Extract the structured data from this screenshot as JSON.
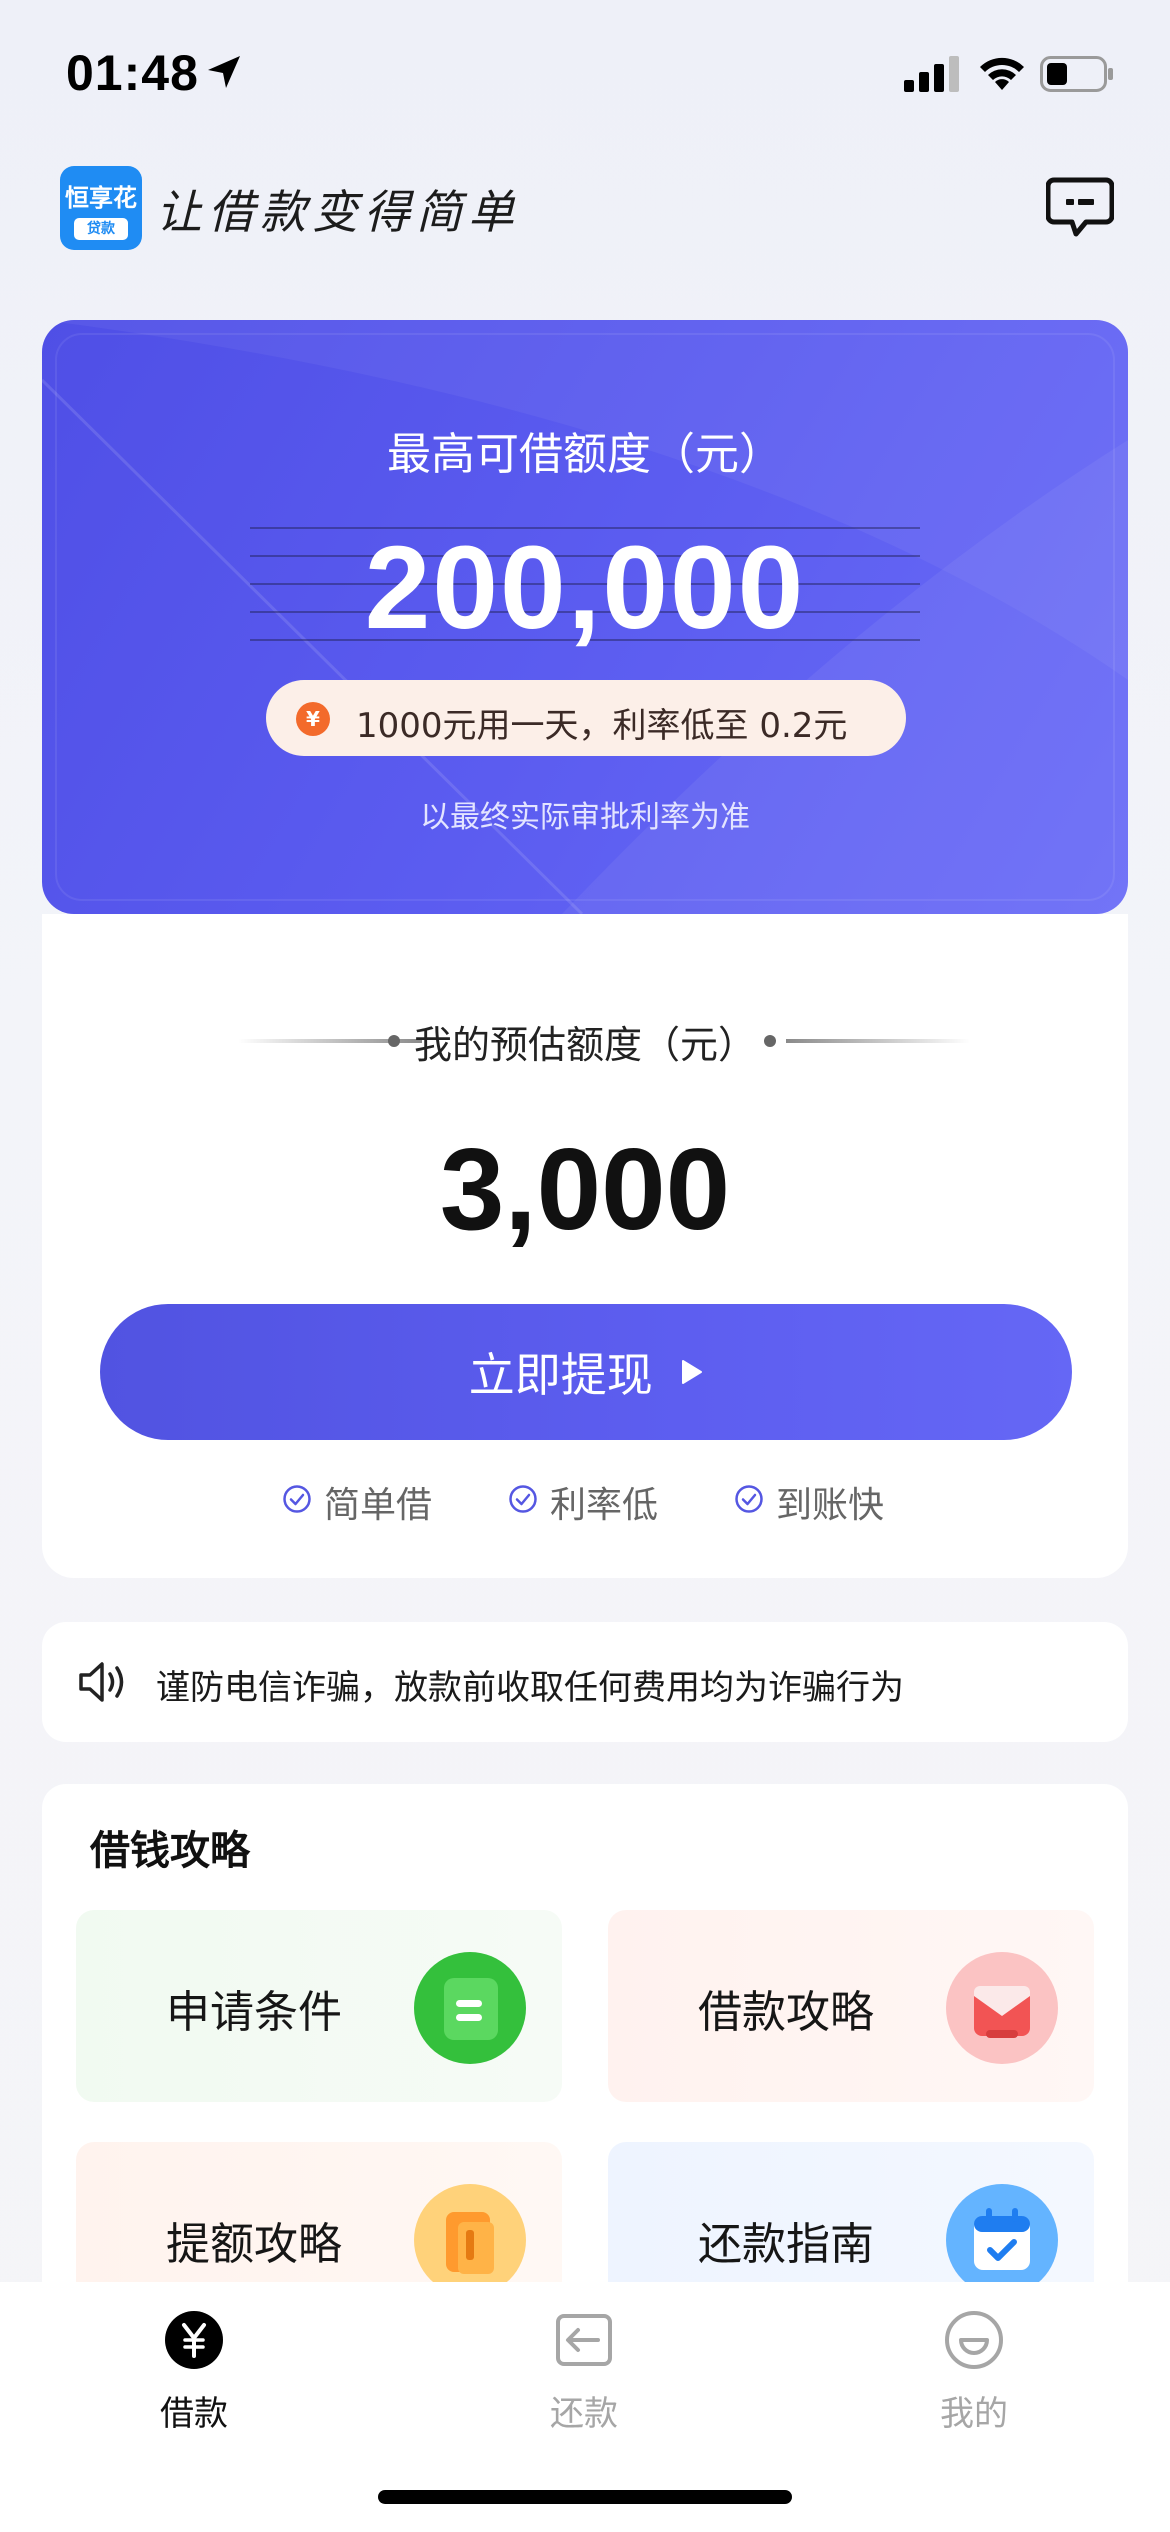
{
  "status_bar": {
    "time": "01:48"
  },
  "header": {
    "logo_text": "恒享花",
    "logo_sub": "贷款",
    "slogan": "让借款变得简单"
  },
  "hero": {
    "title": "最高可借额度（元）",
    "amount": "200,000",
    "promo": "1000元用一天，利率低至 0.2元",
    "note": "以最终实际审批利率为准",
    "accent_color": "#5b5cf0"
  },
  "estimate": {
    "title": "我的预估额度（元）",
    "amount": "3,000",
    "button_label": "立即提现",
    "features": [
      "简单借",
      "利率低",
      "到账快"
    ]
  },
  "notice": {
    "text": "谨防电信诈骗，放款前收取任何费用均为诈骗行为"
  },
  "guide": {
    "title": "借钱攻略",
    "items": [
      {
        "label": "申请条件",
        "icon": "green-document-icon"
      },
      {
        "label": "借款攻略",
        "icon": "red-envelope-icon"
      },
      {
        "label": "提额攻略",
        "icon": "orange-card-icon"
      },
      {
        "label": "还款指南",
        "icon": "blue-calendar-icon"
      }
    ]
  },
  "tabs": [
    {
      "label": "借款",
      "icon": "yuan-icon",
      "active": true
    },
    {
      "label": "还款",
      "icon": "return-icon",
      "active": false
    },
    {
      "label": "我的",
      "icon": "profile-icon",
      "active": false
    }
  ]
}
